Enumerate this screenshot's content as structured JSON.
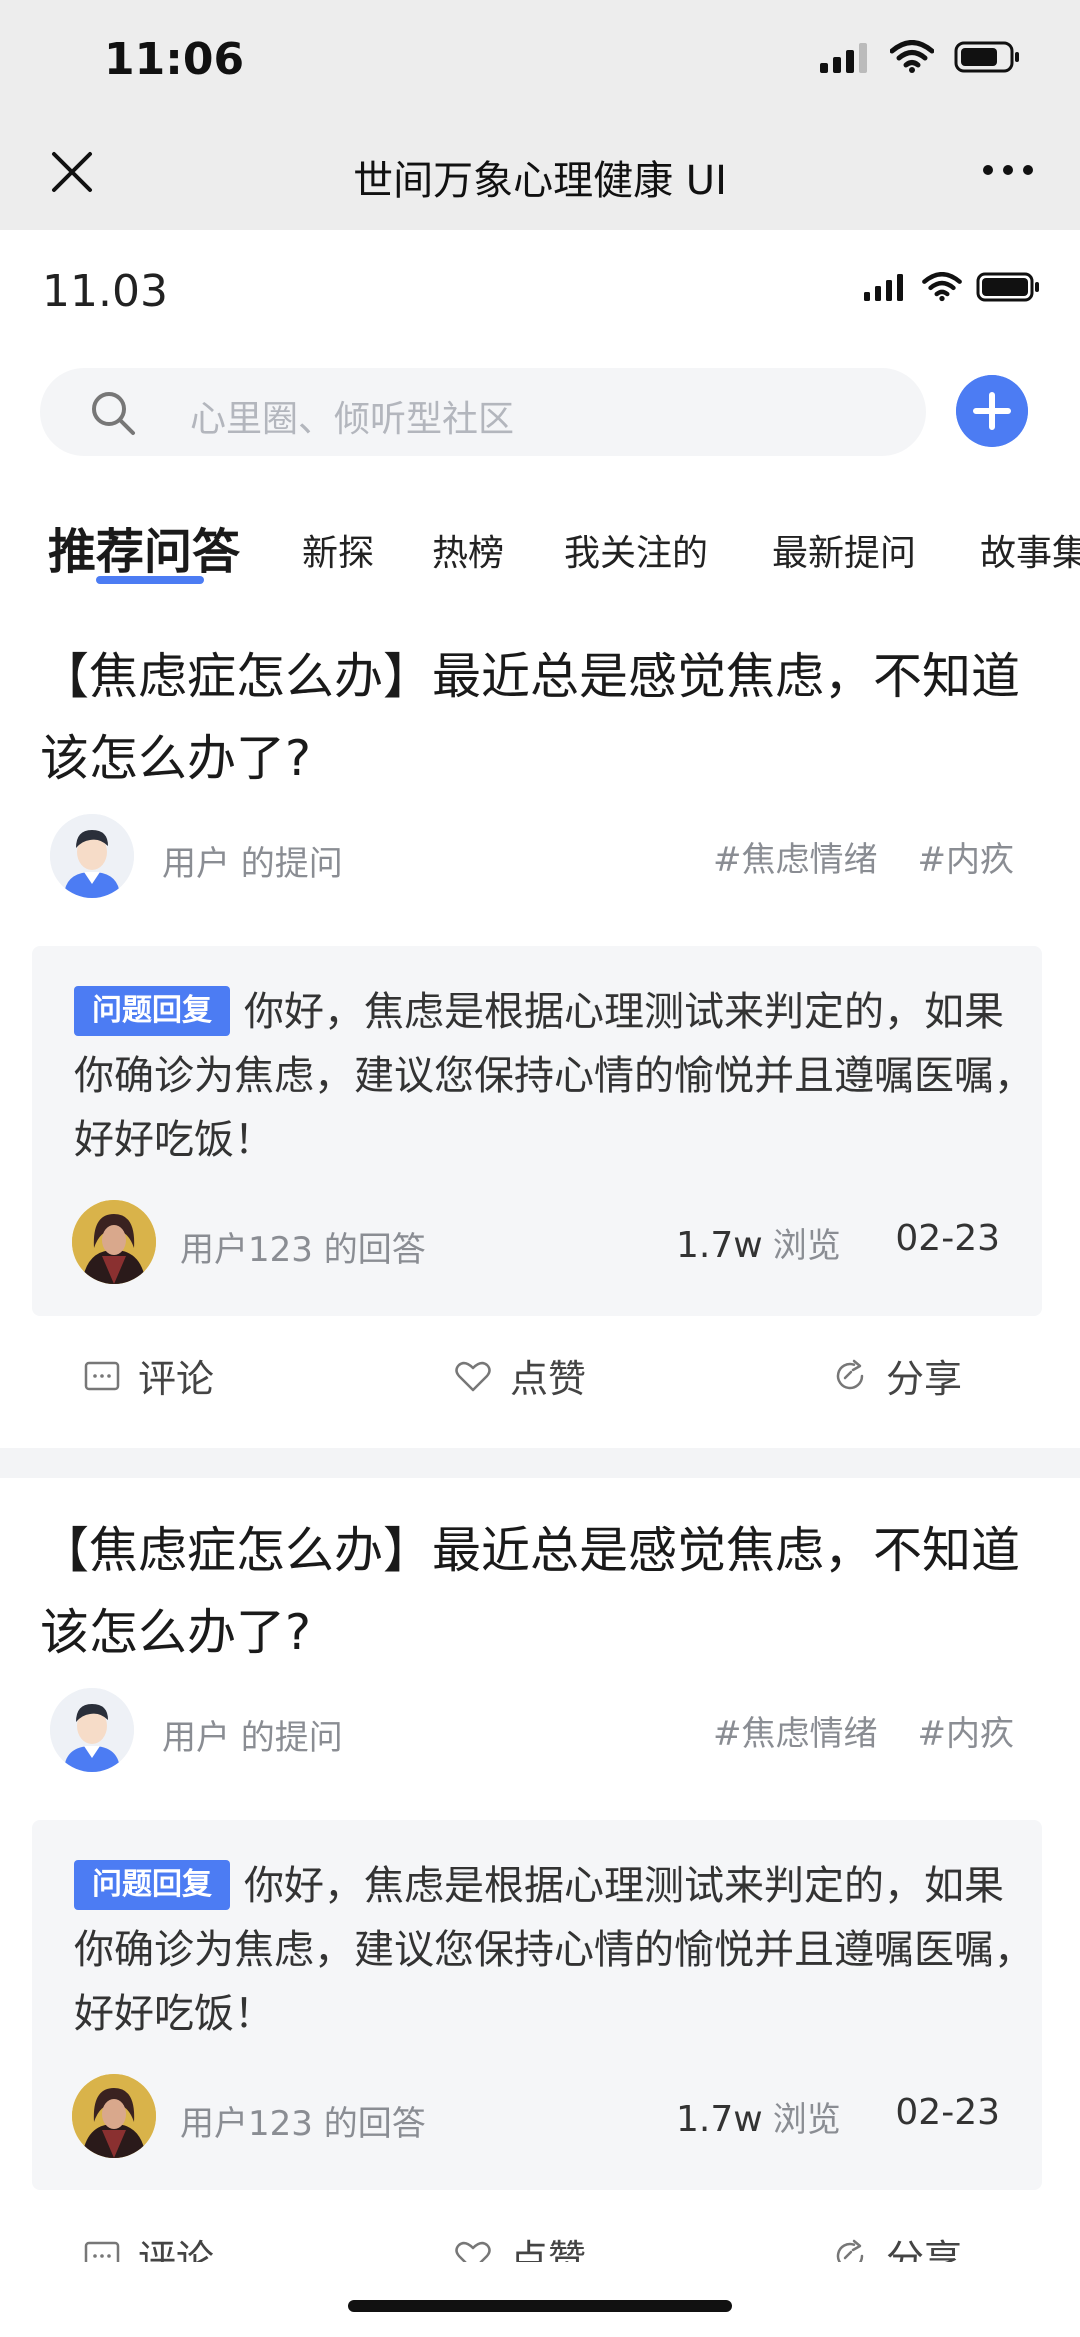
{
  "outer": {
    "time": "11:06",
    "title": "世间万象心理健康 UI"
  },
  "inner": {
    "time": "11.03"
  },
  "search": {
    "placeholder": "心里圈、倾听型社区"
  },
  "tabs": [
    {
      "label": "推荐问答",
      "active": true
    },
    {
      "label": "新探"
    },
    {
      "label": "热榜"
    },
    {
      "label": "我关注的"
    },
    {
      "label": "最新提问"
    },
    {
      "label": "故事集"
    }
  ],
  "posts": [
    {
      "title": "【焦虑症怎么办】最近总是感觉焦虑，不知道该怎么办了?",
      "asker": "用户 的提问",
      "tags": [
        "#焦虑情绪",
        "#内疚"
      ],
      "badge": "问题回复",
      "answer": "你好，焦虑是根据心理测试来判定的，如果你确诊为焦虑，建议您保持心情的愉悦并且遵嘱医嘱，好好吃饭！",
      "answerer": "用户123 的回答",
      "views": "1.7w",
      "views_label": "浏览",
      "date": "02-23",
      "actions": {
        "comment": "评论",
        "like": "点赞",
        "share": "分享"
      }
    },
    {
      "title": "【焦虑症怎么办】最近总是感觉焦虑，不知道该怎么办了?",
      "asker": "用户 的提问",
      "tags": [
        "#焦虑情绪",
        "#内疚"
      ],
      "badge": "问题回复",
      "answer": "你好，焦虑是根据心理测试来判定的，如果你确诊为焦虑，建议您保持心情的愉悦并且遵嘱医嘱，好好吃饭！",
      "answerer": "用户123 的回答",
      "views": "1.7w",
      "views_label": "浏览",
      "date": "02-23",
      "actions": {
        "comment": "评论",
        "like": "点赞",
        "share": "分享"
      }
    }
  ],
  "colors": {
    "accent": "#4c7cf3",
    "muted": "#8a8d93",
    "panel": "#f5f6f8"
  }
}
